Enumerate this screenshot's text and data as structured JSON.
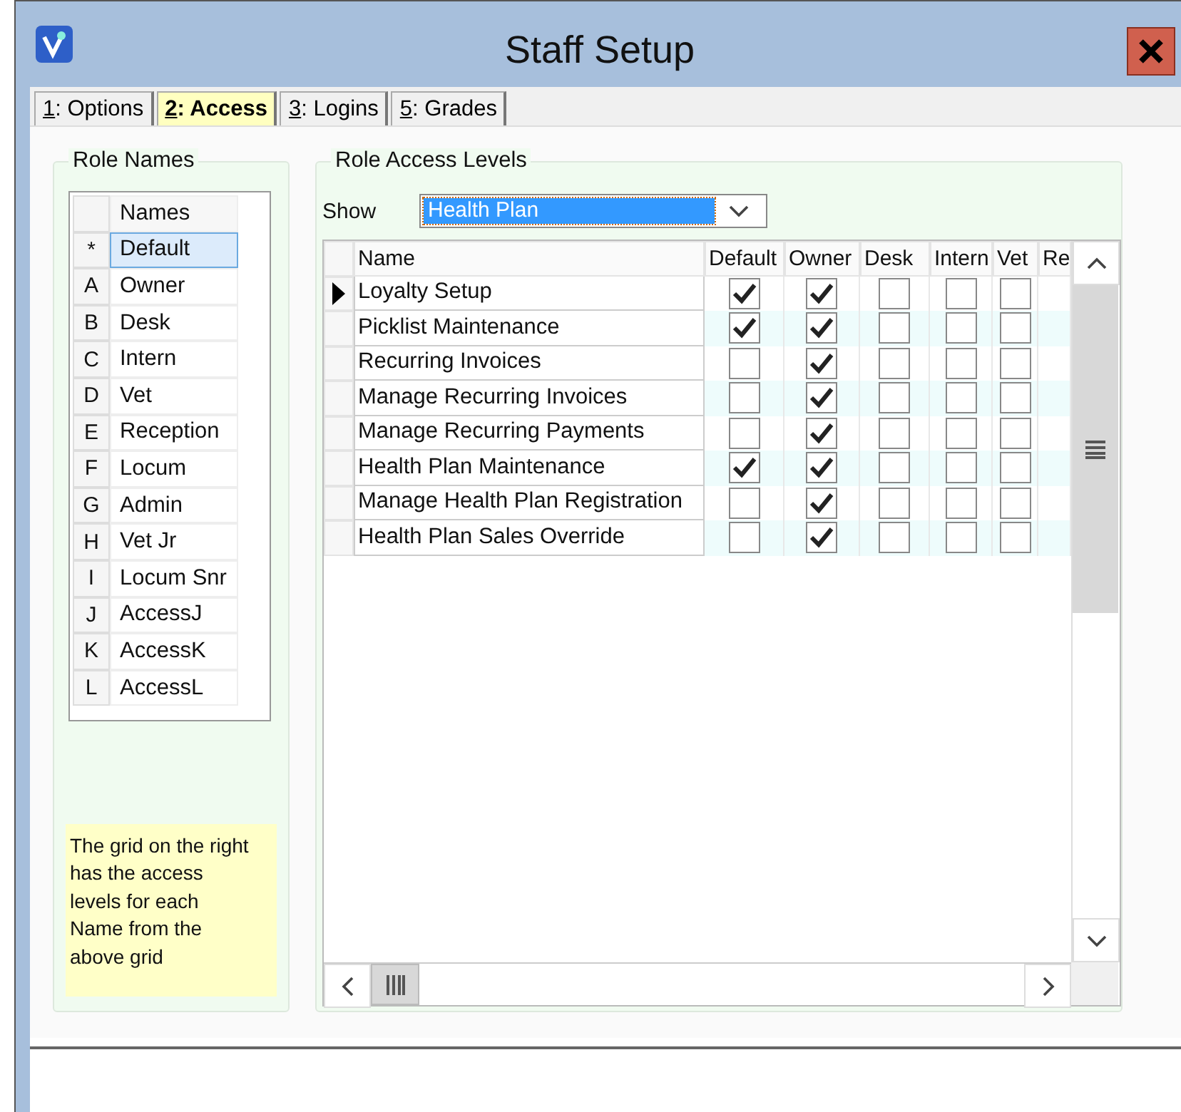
{
  "window": {
    "title": "Staff Setup"
  },
  "tabs": [
    {
      "key": "1",
      "label": ": Options",
      "selected": false
    },
    {
      "key": "2",
      "label": ": Access",
      "selected": true
    },
    {
      "key": "3",
      "label": ": Logins",
      "selected": false
    },
    {
      "key": "5",
      "label": ": Grades",
      "selected": false
    }
  ],
  "role_names": {
    "title": "Role Names",
    "column": "Names",
    "rows": [
      {
        "code": "*",
        "name": "Default",
        "selected": true
      },
      {
        "code": "A",
        "name": "Owner",
        "selected": false
      },
      {
        "code": "B",
        "name": "Desk",
        "selected": false
      },
      {
        "code": "C",
        "name": "Intern",
        "selected": false
      },
      {
        "code": "D",
        "name": "Vet",
        "selected": false
      },
      {
        "code": "E",
        "name": "Reception",
        "selected": false
      },
      {
        "code": "F",
        "name": "Locum",
        "selected": false
      },
      {
        "code": "G",
        "name": "Admin",
        "selected": false
      },
      {
        "code": "H",
        "name": "Vet Jr",
        "selected": false
      },
      {
        "code": "I",
        "name": "Locum Snr",
        "selected": false
      },
      {
        "code": "J",
        "name": "AccessJ",
        "selected": false
      },
      {
        "code": "K",
        "name": "AccessK",
        "selected": false
      },
      {
        "code": "L",
        "name": "AccessL",
        "selected": false
      }
    ]
  },
  "hint": "The grid on the right has the access levels for each Name from the above grid",
  "access": {
    "title": "Role Access Levels",
    "show_label": "Show",
    "show_value": "Health Plan",
    "columns": [
      "Name",
      "Default",
      "Owner",
      "Desk",
      "Intern",
      "Vet",
      "Re"
    ],
    "rows": [
      {
        "name": "Loyalty Setup",
        "current": true,
        "checks": [
          true,
          true,
          false,
          false,
          false
        ]
      },
      {
        "name": "Picklist Maintenance",
        "current": false,
        "checks": [
          true,
          true,
          false,
          false,
          false
        ]
      },
      {
        "name": "Recurring Invoices",
        "current": false,
        "checks": [
          false,
          true,
          false,
          false,
          false
        ]
      },
      {
        "name": "Manage Recurring Invoices",
        "current": false,
        "checks": [
          false,
          true,
          false,
          false,
          false
        ]
      },
      {
        "name": "Manage Recurring Payments",
        "current": false,
        "checks": [
          false,
          true,
          false,
          false,
          false
        ]
      },
      {
        "name": "Health Plan Maintenance",
        "current": false,
        "checks": [
          true,
          true,
          false,
          false,
          false
        ]
      },
      {
        "name": "Manage Health Plan Registration",
        "current": false,
        "checks": [
          false,
          true,
          false,
          false,
          false
        ]
      },
      {
        "name": "Health Plan Sales Override",
        "current": false,
        "checks": [
          false,
          true,
          false,
          false,
          false
        ]
      }
    ]
  }
}
